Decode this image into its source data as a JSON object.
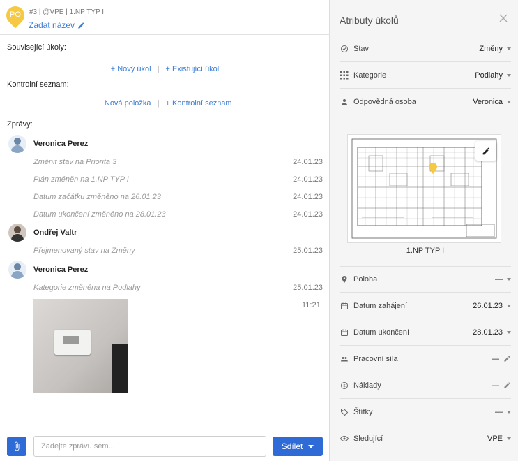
{
  "header": {
    "avatar_initials": "PO",
    "task_meta": "#3 | @VPE | 1.NP TYP I",
    "set_name_link": "Zadat název"
  },
  "related_tasks": {
    "title": "Související úkoly:",
    "new_link": "+ Nový úkol",
    "existing_link": "+ Existující úkol",
    "separator": "|"
  },
  "checklist": {
    "title": "Kontrolní seznam:",
    "new_item_link": "+ Nová položka",
    "checklist_link": "+ Kontrolní seznam",
    "separator": "|"
  },
  "messages": {
    "title": "Zprávy:",
    "groups": [
      {
        "author": "Veronica Perez",
        "lines": [
          {
            "text": "Změnit stav na Priorita 3",
            "date": "24.01.23"
          },
          {
            "text": "Plán změněn na 1.NP TYP I",
            "date": "24.01.23"
          },
          {
            "text": "Datum začátku změněno na 26.01.23",
            "date": "24.01.23"
          },
          {
            "text": "Datum ukončení změněno na 28.01.23",
            "date": "24.01.23"
          }
        ]
      },
      {
        "author": "Ondřej Valtr",
        "lines": [
          {
            "text": "Přejmenovaný stav na Změny",
            "date": "25.01.23"
          }
        ]
      },
      {
        "author": "Veronica Perez",
        "lines": [
          {
            "text": "Kategorie změněna na Podlahy",
            "date": "25.01.23"
          }
        ],
        "photo_time": "11:21"
      }
    ]
  },
  "composer": {
    "placeholder": "Zadejte zprávu sem...",
    "share_label": "Sdílet"
  },
  "attributes": {
    "title": "Atributy úkolů",
    "status": {
      "label": "Stav",
      "value": "Změny"
    },
    "category": {
      "label": "Kategorie",
      "value": "Podlahy"
    },
    "assignee": {
      "label": "Odpovědná osoba",
      "value": "Veronica"
    },
    "plan_caption": "1.NP TYP I",
    "location": {
      "label": "Poloha",
      "value": "—"
    },
    "start_date": {
      "label": "Datum zahájení",
      "value": "26.01.23"
    },
    "end_date": {
      "label": "Datum ukončení",
      "value": "28.01.23"
    },
    "workforce": {
      "label": "Pracovní síla",
      "value": "—"
    },
    "costs": {
      "label": "Náklady",
      "value": "—"
    },
    "tags": {
      "label": "Štítky",
      "value": "—"
    },
    "watchers": {
      "label": "Sledující",
      "value": "VPE"
    }
  },
  "colors": {
    "accent": "#2f6bd6",
    "link": "#3b7dd8",
    "pin": "#f6c945",
    "panel_bg": "#f5f5f5"
  }
}
